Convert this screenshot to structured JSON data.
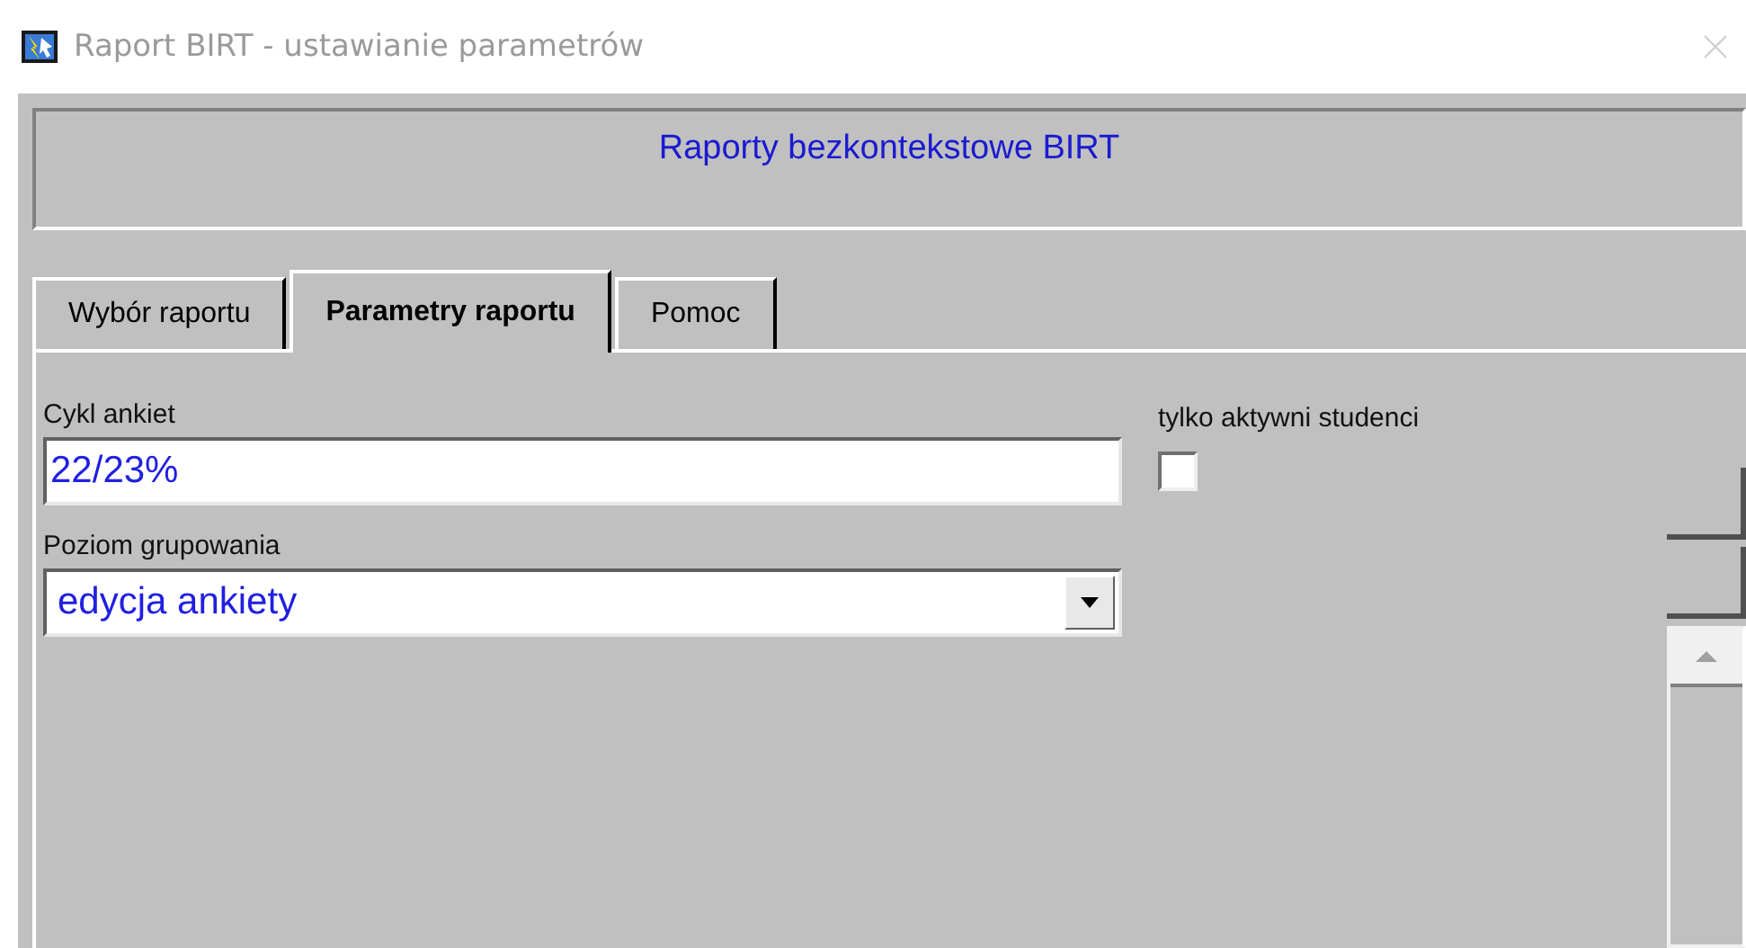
{
  "window": {
    "title": "Raport BIRT - ustawianie parametrów"
  },
  "header": {
    "title": "Raporty bezkontekstowe BIRT"
  },
  "tabs": [
    {
      "label": "Wybór raportu",
      "selected": false
    },
    {
      "label": "Parametry raportu",
      "selected": true
    },
    {
      "label": "Pomoc",
      "selected": false
    }
  ],
  "fields": [
    {
      "kind": "text",
      "label": "Cykl ankiet",
      "value": "22/23%"
    },
    {
      "kind": "dropdown",
      "label": "Poziom grupowania",
      "value": "edycja ankiety"
    }
  ],
  "checkbox": {
    "label": "tylko aktywni studenci",
    "checked": false
  }
}
